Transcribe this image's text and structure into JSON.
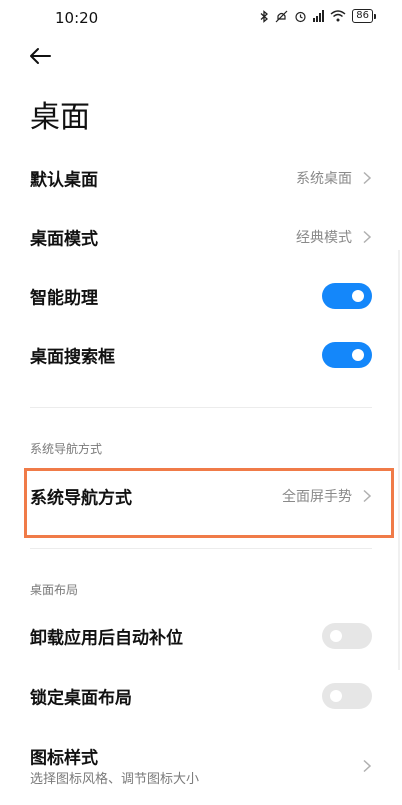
{
  "status_bar": {
    "time": "10:20",
    "battery": "86"
  },
  "header": {
    "title": "桌面"
  },
  "rows": [
    {
      "label": "默认桌面",
      "value": "系统桌面"
    },
    {
      "label": "桌面模式",
      "value": "经典模式"
    },
    {
      "label": "智能助理",
      "toggle": true
    },
    {
      "label": "桌面搜索框",
      "toggle": true
    }
  ],
  "section_nav": {
    "header": "系统导航方式",
    "row": {
      "label": "系统导航方式",
      "value": "全面屏手势"
    }
  },
  "section_layout": {
    "header": "桌面布局",
    "rows": [
      {
        "label": "卸载应用后自动补位",
        "toggle": false
      },
      {
        "label": "锁定桌面布局",
        "toggle": false
      }
    ]
  },
  "icon_style": {
    "label": "图标样式",
    "subtitle": "选择图标风格、调节图标大小"
  },
  "colors": {
    "accent": "#1487fa",
    "highlight": "#f07b48"
  }
}
